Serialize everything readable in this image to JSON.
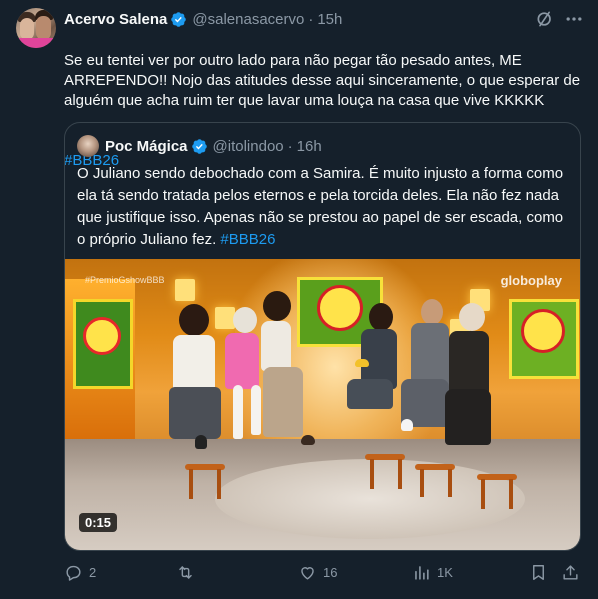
{
  "tweet": {
    "author": {
      "display_name": "Acervo Salena",
      "handle": "@salenasacervo",
      "time": "15h"
    },
    "text_main": "Se eu tentei ver por outro lado para não pegar tão pesado antes, ME ARREPENDO!! Nojo das atitudes desse aqui sinceramente, o que esperar de alguém que acha ruim ter que lavar uma louça na casa que vive KKKKK",
    "hashtag": "#BBB26"
  },
  "quoted": {
    "author": {
      "display_name": "Poc Mágica",
      "handle": "@itolindoo",
      "time": "16h"
    },
    "text_main": "O Juliano sendo debochado com a Samira. É muito injusto a forma como ela tá sendo tratada pelos eternos e pela torcida deles. Ela não fez nada que justifique isso. Apenas não se prestou ao papel de ser escada, como o próprio Juliano fez.",
    "hashtag": "#BBB26",
    "video": {
      "watermark_left": "#PremioGshowBBB",
      "watermark_right": "globoplay",
      "duration": "0:15"
    }
  },
  "actions": {
    "replies": "2",
    "reposts": "",
    "likes": "16",
    "views": "1K"
  },
  "colors": {
    "background": "#15202b",
    "text": "#f7f9f9",
    "muted": "#8b98a5",
    "accent": "#1d9bf0",
    "border": "#38444d"
  },
  "icons": [
    "verified-badge-icon",
    "grok-icon",
    "more-icon",
    "reply-icon",
    "repost-icon",
    "like-icon",
    "views-icon",
    "bookmark-icon",
    "share-icon"
  ]
}
